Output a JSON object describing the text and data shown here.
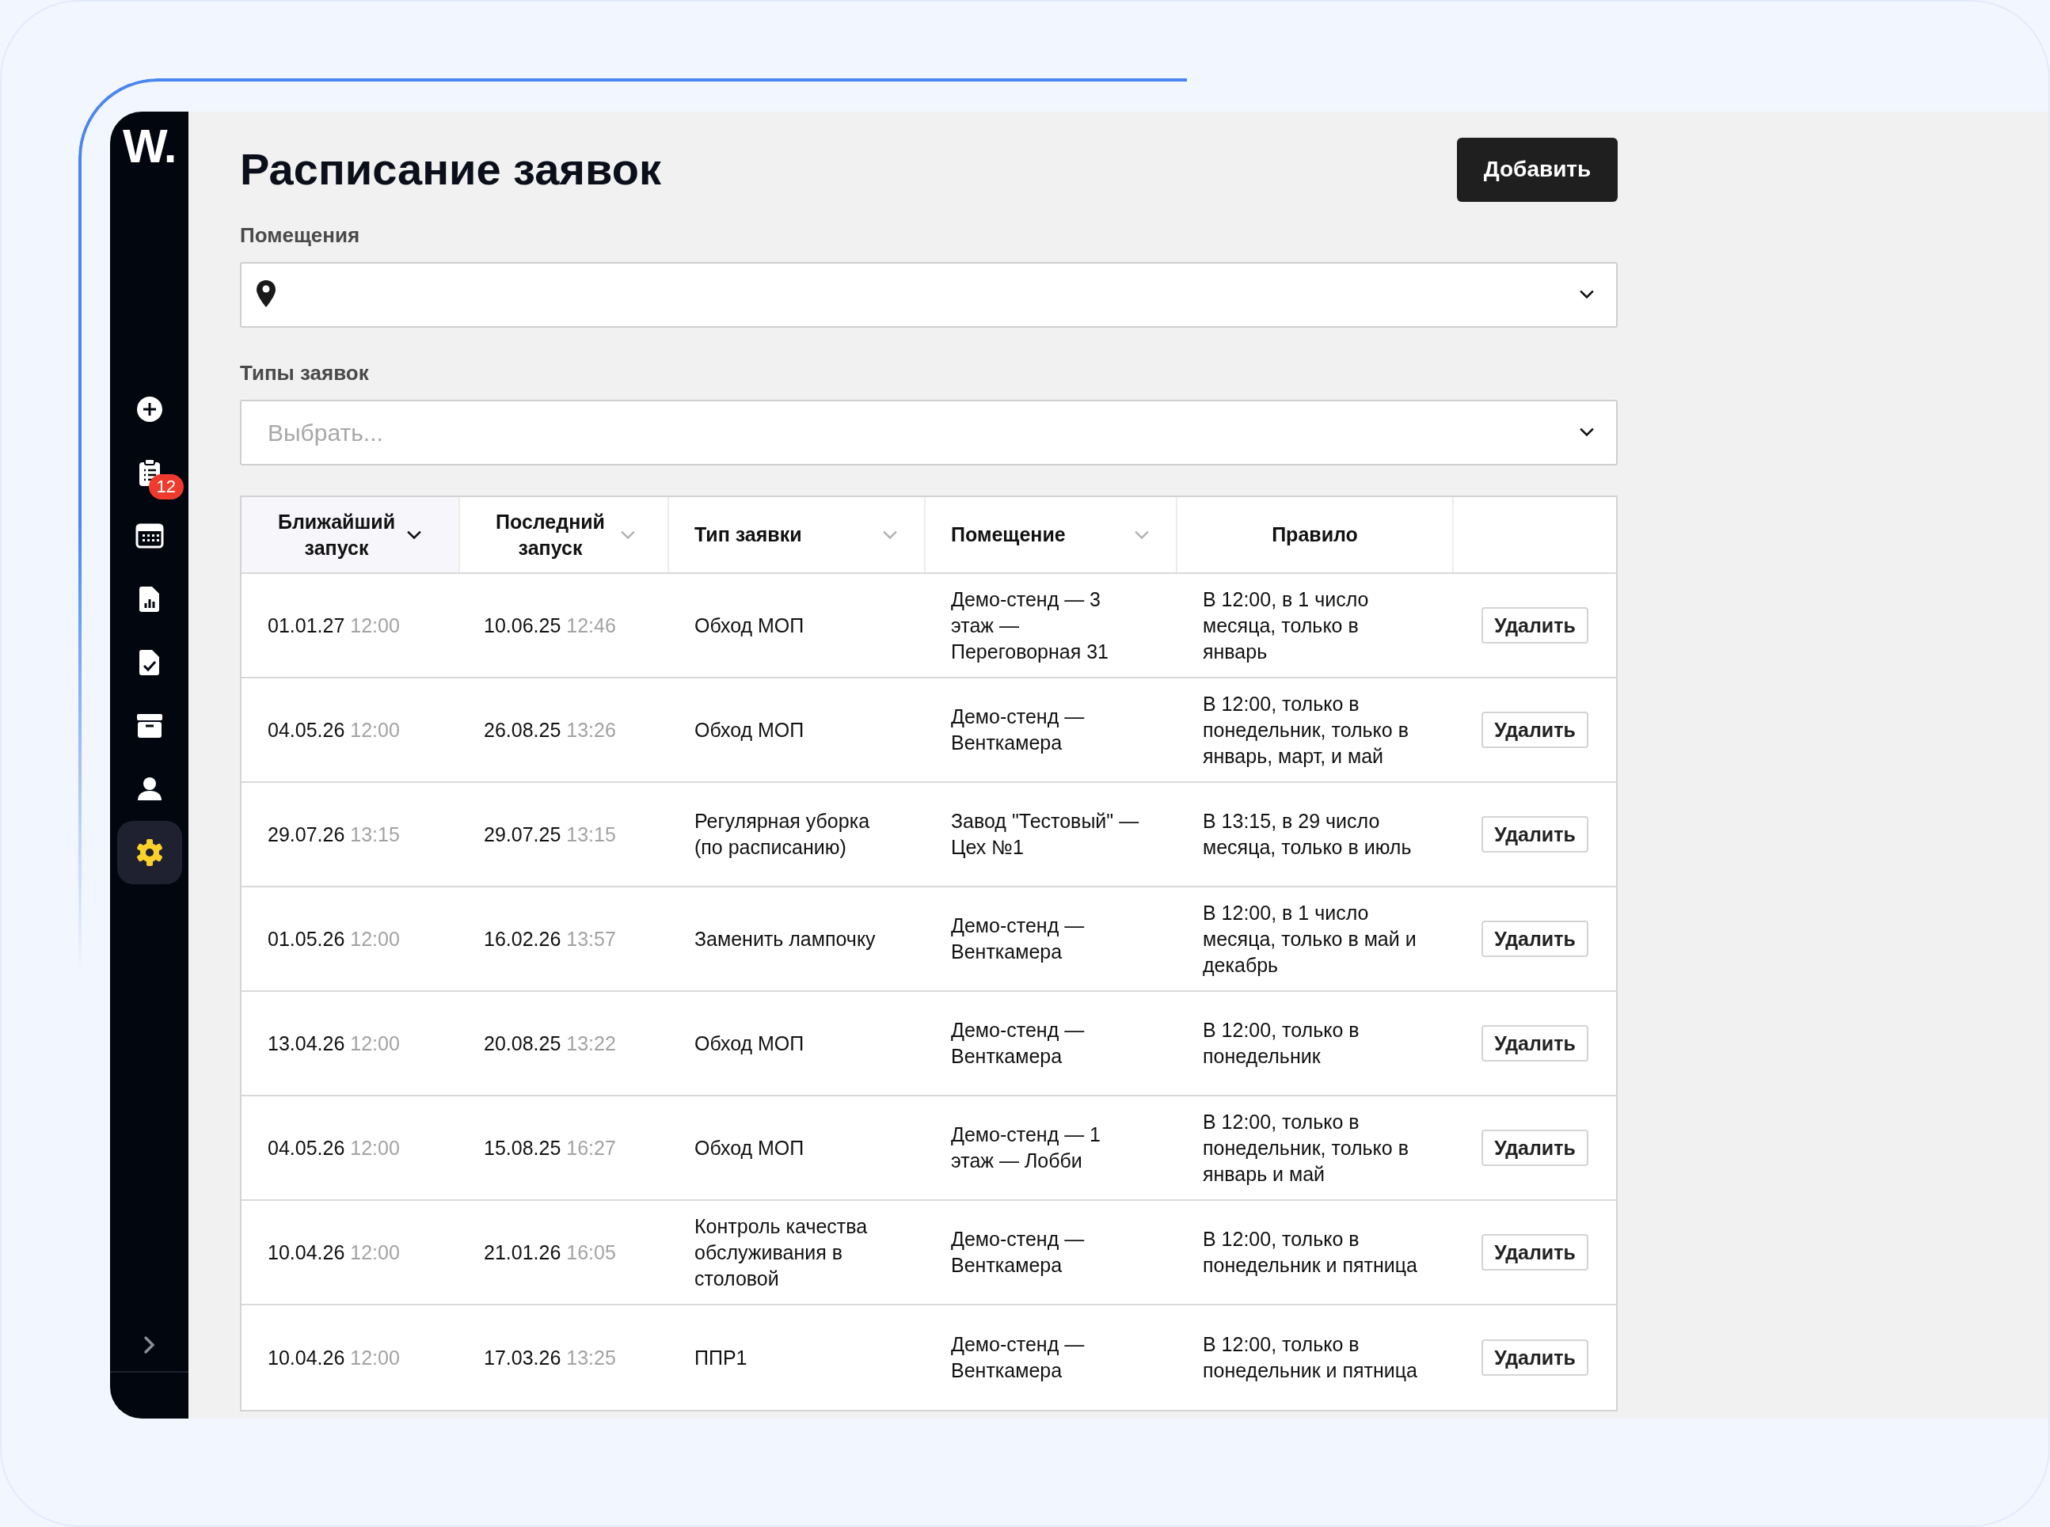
{
  "sidebar": {
    "logo": "W.",
    "items": [
      {
        "selected": false
      },
      {
        "selected": false,
        "badge": "12"
      },
      {
        "selected": false
      },
      {
        "selected": false
      },
      {
        "selected": false
      },
      {
        "selected": false
      },
      {
        "selected": false
      },
      {
        "selected": true
      }
    ]
  },
  "title": "Расписание заявок",
  "add_button": "Добавить",
  "filters": [
    {
      "label": "Помещения",
      "kind": "location"
    },
    {
      "label": "Типы заявок",
      "kind": "plain",
      "placeholder": "Выбрать..."
    }
  ],
  "table": {
    "columns": [
      {
        "label": "Ближайший запуск",
        "sortable": true,
        "sorted": true
      },
      {
        "label": "Последний запуск",
        "sortable": true,
        "sorted": false
      },
      {
        "label": "Тип заявки",
        "sortable": true,
        "sorted": false
      },
      {
        "label": "Помещение",
        "sortable": true,
        "sorted": false
      },
      {
        "label": "Правило",
        "sortable": false
      }
    ],
    "rows": [
      {
        "next_date": "01.01.27",
        "next_time": "12:00",
        "last_date": "10.06.25",
        "last_time": "12:46",
        "type": "Обход МОП",
        "room": "Демо-стенд — 3 этаж — Переговорная 31",
        "rule": "В 12:00, в 1 число месяца, только в январь",
        "action": "Удалить"
      },
      {
        "next_date": "04.05.26",
        "next_time": "12:00",
        "last_date": "26.08.25",
        "last_time": "13:26",
        "type": "Обход МОП",
        "room": "Демо-стенд — Венткамера",
        "rule": "В 12:00, только в понедельник, только в январь, март, и май",
        "action": "Удалить"
      },
      {
        "next_date": "29.07.26",
        "next_time": "13:15",
        "last_date": "29.07.25",
        "last_time": "13:15",
        "type": "Регулярная уборка (по расписанию)",
        "room": "Завод \"Тестовый\" — Цех №1",
        "rule": "В 13:15, в 29 число месяца, только в июль",
        "action": "Удалить"
      },
      {
        "next_date": "01.05.26",
        "next_time": "12:00",
        "last_date": "16.02.26",
        "last_time": "13:57",
        "type": "Заменить лампочку",
        "room": "Демо-стенд — Венткамера",
        "rule": "В 12:00, в 1 число месяца, только в май и декабрь",
        "action": "Удалить"
      },
      {
        "next_date": "13.04.26",
        "next_time": "12:00",
        "last_date": "20.08.25",
        "last_time": "13:22",
        "type": "Обход МОП",
        "room": "Демо-стенд — Венткамера",
        "rule": "В 12:00, только в понедельник",
        "action": "Удалить"
      },
      {
        "next_date": "04.05.26",
        "next_time": "12:00",
        "last_date": "15.08.25",
        "last_time": "16:27",
        "type": "Обход МОП",
        "room": "Демо-стенд — 1 этаж — Лобби",
        "rule": "В 12:00, только в понедельник, только в январь и май",
        "action": "Удалить"
      },
      {
        "next_date": "10.04.26",
        "next_time": "12:00",
        "last_date": "21.01.26",
        "last_time": "16:05",
        "type": "Контроль качества обслуживания в столовой",
        "room": "Демо-стенд — Венткамера",
        "rule": "В 12:00, только в понедельник и пятница",
        "action": "Удалить"
      },
      {
        "next_date": "10.04.26",
        "next_time": "12:00",
        "last_date": "17.03.26",
        "last_time": "13:25",
        "type": "ППР1",
        "room": "Демо-стенд — Венткамера",
        "rule": "В 12:00, только в понедельник и пятница",
        "action": "Удалить"
      }
    ]
  }
}
